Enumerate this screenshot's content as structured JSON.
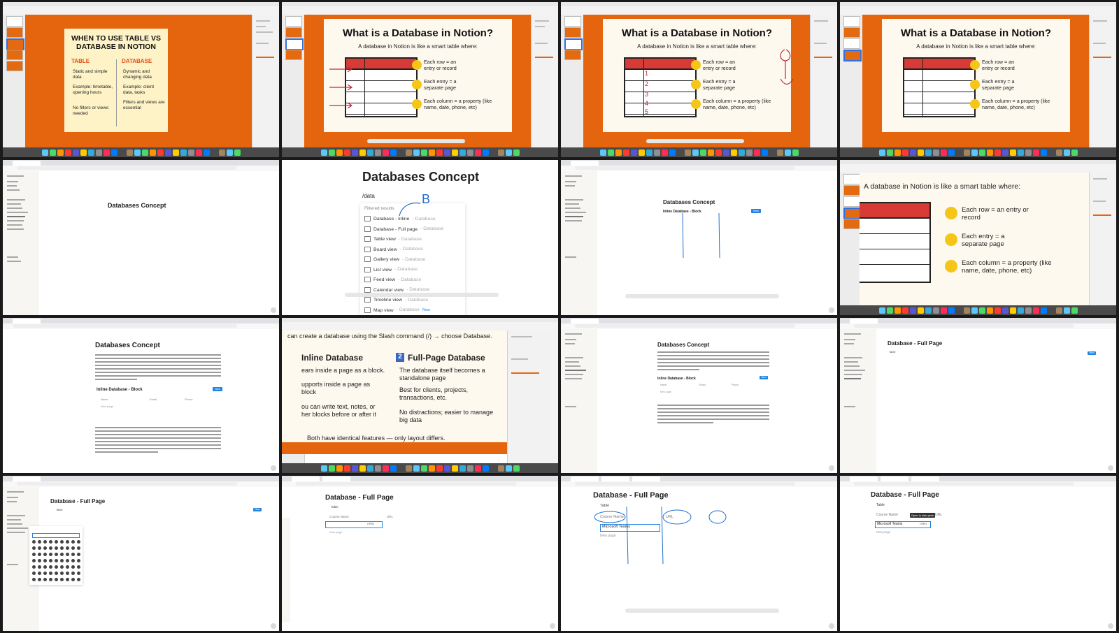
{
  "colors": {
    "slide_orange": "#e5650f",
    "table_header_red": "#d83b36",
    "bullet_yellow": "#f5c518",
    "cream_card": "#fdf3c7",
    "table_title_red": "#e0501a",
    "annotation_blue": "#1f6fd1",
    "annotation_red": "#c0283a",
    "notion_blue_button": "#2383e2"
  },
  "slide_when": {
    "title": "WHEN TO USE TABLE VS DATABASE IN NOTION",
    "table_heading": "TABLE",
    "database_heading": "DATABASE",
    "table_points": [
      "Static and simple data",
      "Example: timetable, opening hours",
      "No filters or views needed"
    ],
    "database_points": [
      "Dynamic and changing data",
      "Example: client data, tasks",
      "Filters and views are essential"
    ]
  },
  "slide_what": {
    "title": "What is a Database in Notion?",
    "subtitle": "A database in Notion is like a smart table where:",
    "bullets": [
      {
        "icon": "list-icon",
        "text": "Each row = an entry or record"
      },
      {
        "icon": "page-icon",
        "text": "Each entry = a separate page"
      },
      {
        "icon": "columns-icon",
        "text": "Each column = a property (like name, date, phone, etc)"
      }
    ],
    "annotation_numbers": [
      "1",
      "2",
      "3",
      "4",
      "5"
    ]
  },
  "notion": {
    "page_title": "Databases Concept",
    "slash_command": "/data",
    "filtered_results": "Filtered results",
    "menu_items": [
      {
        "label": "Database - Inline",
        "type": "Database"
      },
      {
        "label": "Database - Full page",
        "type": "Database"
      },
      {
        "label": "Table view",
        "type": "Database"
      },
      {
        "label": "Board view",
        "type": "Database"
      },
      {
        "label": "Gallery view",
        "type": "Database"
      },
      {
        "label": "List view",
        "type": "Database"
      },
      {
        "label": "Feed view",
        "type": "Database"
      },
      {
        "label": "Calendar view",
        "type": "Database"
      },
      {
        "label": "Timeline view",
        "type": "Database"
      },
      {
        "label": "Map view",
        "type": "Database",
        "badge": "New"
      }
    ],
    "annotation_letter": "B",
    "inline_block_title": "Inline Database - Block",
    "new_button": "New",
    "col_name": "Name",
    "col_email": "Email",
    "col_phone": "Phone",
    "new_page": "New page",
    "full_page_title": "Database - Full Page",
    "table_tab": "Table",
    "course_name": "Course Name",
    "url_col": "URL",
    "row_value": "Microsoft Teams",
    "open_label": "OPEN",
    "tooltip": "Open in side peek"
  },
  "slide_create": {
    "intro": "can create a database using the Slash command (/) → choose Database.",
    "left_heading": "Inline Database",
    "left_points": [
      "ears inside a page as a block.",
      "upports inside a page as block",
      "ou can write text, notes, or her blocks before or after it"
    ],
    "right_num": "2",
    "right_heading": "Full-Page Database",
    "right_points": [
      "The database itself becomes a standalone page",
      "Best for clients, projects, transactions, etc.",
      "No distractions; easier to manage big data"
    ],
    "footer": "Both have identical features — only layout differs."
  }
}
